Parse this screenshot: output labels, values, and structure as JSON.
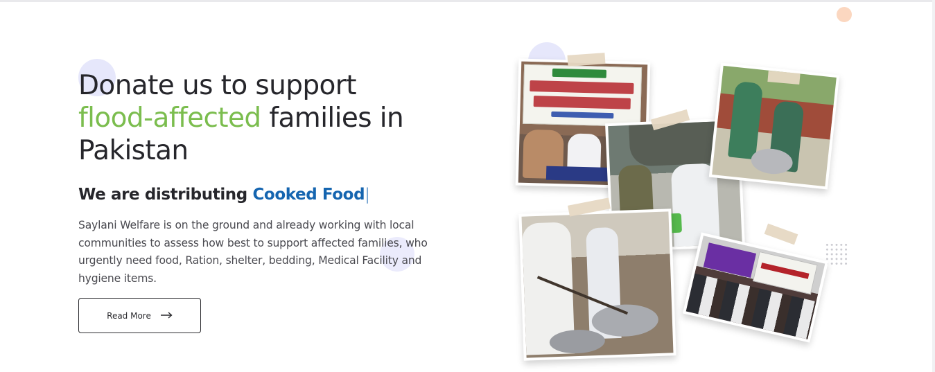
{
  "hero": {
    "headline_pre": "Donate us to support",
    "headline_highlight": "flood-affected",
    "headline_post": "families in",
    "headline_last": "Pakistan",
    "subhead_prefix": "We are distributing",
    "subhead_highlight": "Cooked Food",
    "subhead_cursor": "|",
    "description": "Saylani Welfare is on the ground and already working with local communities to assess how best to support affected families, who urgently need food, Ration, shelter, bedding, Medical Facility and hygiene items.",
    "read_more_label": "Read More"
  },
  "collage": {
    "photos": [
      {
        "name": "relief-camp-photo"
      },
      {
        "name": "volunteer-army-photo"
      },
      {
        "name": "cooking-photo"
      },
      {
        "name": "cooked-food-distribution-photo"
      },
      {
        "name": "crowd-banners-photo"
      }
    ]
  },
  "colors": {
    "highlight_green": "#7bbd4e",
    "highlight_blue": "#1565b0",
    "text_dark": "#26262b"
  },
  "icons": {
    "read_more": "arrow-right-icon"
  }
}
